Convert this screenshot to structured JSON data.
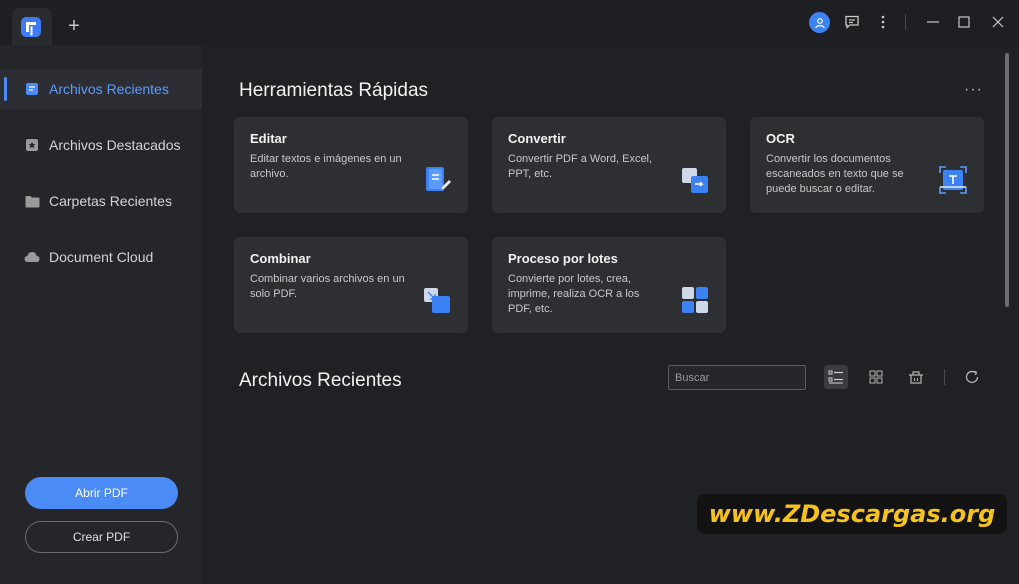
{
  "titlebar": {
    "new_tab_symbol": "+",
    "icons": [
      "app-logo-icon",
      "user-icon",
      "feedback-icon",
      "more-vertical-icon",
      "minimize-icon",
      "maximize-icon",
      "close-icon"
    ],
    "accent": "#3d82f4"
  },
  "sidebar": {
    "items": [
      {
        "label": "Archivos Recientes",
        "icon": "recent-files-icon",
        "active": true
      },
      {
        "label": "Archivos Destacados",
        "icon": "star-icon",
        "active": false
      },
      {
        "label": "Carpetas Recientes",
        "icon": "folder-icon",
        "active": false
      },
      {
        "label": "Document Cloud",
        "icon": "cloud-icon",
        "active": false
      }
    ],
    "open_pdf_label": "Abrir PDF",
    "create_pdf_label": "Crear PDF",
    "accent": "#4b8bf5"
  },
  "quick_tools": {
    "title": "Herramientas Rápidas",
    "more": "···",
    "cards": [
      {
        "title": "Editar",
        "description": "Editar textos e imágenes en un archivo.",
        "icon": "edit-document-icon"
      },
      {
        "title": "Convertir",
        "description": "Convertir PDF a Word, Excel, PPT, etc.",
        "icon": "convert-icon"
      },
      {
        "title": "OCR",
        "description": "Convertir los documentos escaneados en texto que se puede buscar o editar.",
        "icon": "ocr-scan-icon"
      },
      {
        "title": "Combinar",
        "description": "Combinar varios archivos en un solo PDF.",
        "icon": "combine-icon"
      },
      {
        "title": "Proceso por lotes",
        "description": "Convierte por lotes, crea, imprime, realiza OCR a los PDF, etc.",
        "icon": "batch-process-icon"
      }
    ]
  },
  "recent_files": {
    "title": "Archivos Recientes",
    "search_placeholder": "Buscar",
    "view_buttons": [
      "list-view-icon",
      "grid-view-icon",
      "clear-history-icon",
      "refresh-icon"
    ]
  },
  "watermark": "www.ZDescargas.org"
}
